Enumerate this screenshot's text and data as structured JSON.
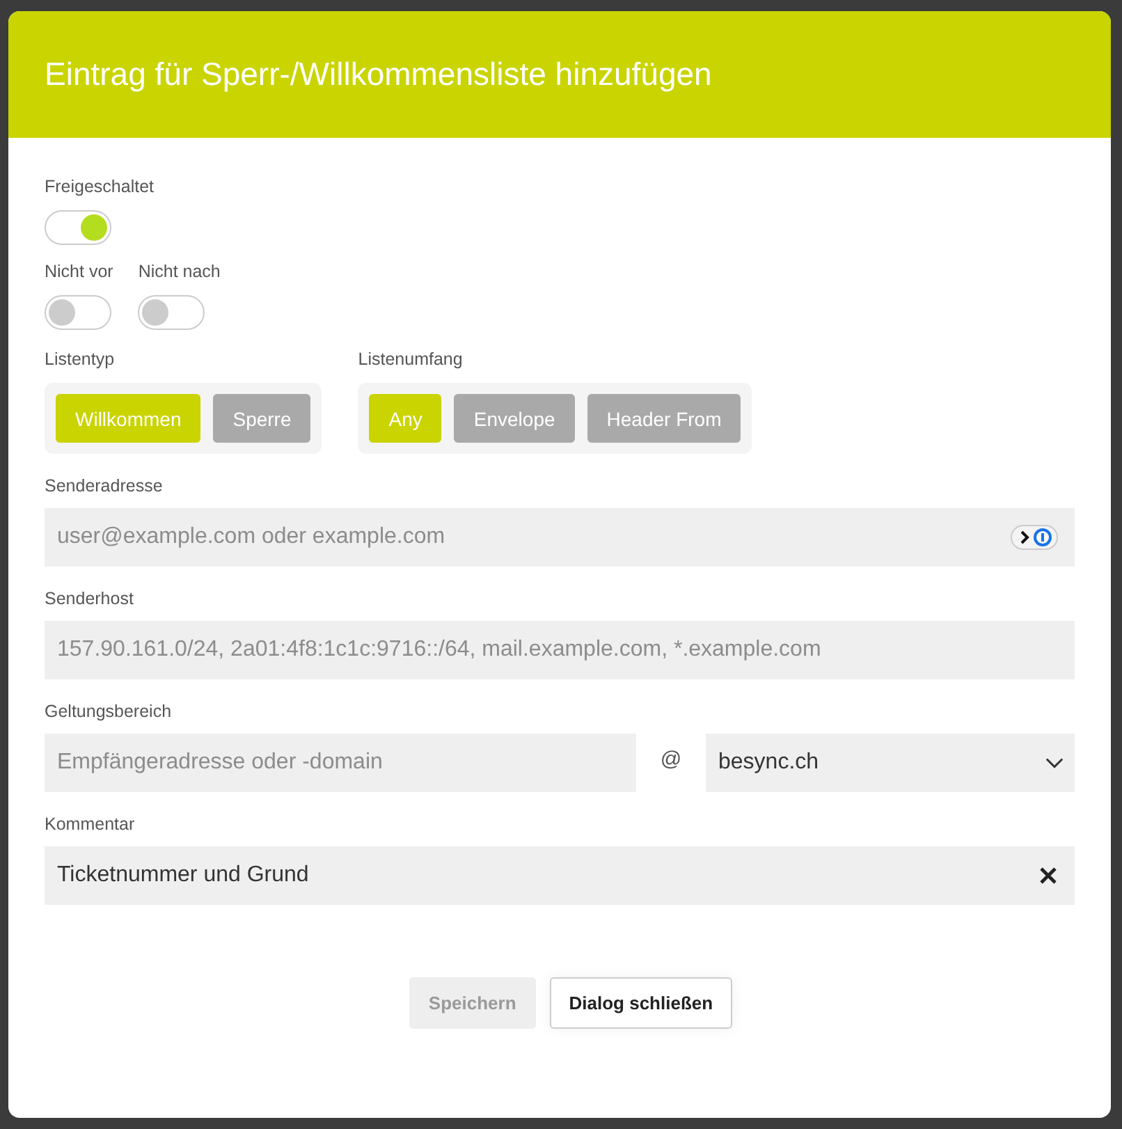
{
  "dialog": {
    "title": "Eintrag für Sperr-/Willkommensliste hinzufügen"
  },
  "switch_rows": [
    {
      "switches": [
        {
          "label": "Freigeschaltet",
          "on": true
        }
      ]
    },
    {
      "switches": [
        {
          "label": "Nicht vor",
          "on": false
        },
        {
          "label": "Nicht nach",
          "on": false
        }
      ]
    }
  ],
  "segment_groups": [
    {
      "label": "Listentyp",
      "options": [
        {
          "label": "Willkommen",
          "selected": true
        },
        {
          "label": "Sperre",
          "selected": false
        }
      ]
    },
    {
      "label": "Listenumfang",
      "options": [
        {
          "label": "Any",
          "selected": true
        },
        {
          "label": "Envelope",
          "selected": false
        },
        {
          "label": "Header From",
          "selected": false
        }
      ]
    }
  ],
  "fields": [
    {
      "kind": "text",
      "label": "Senderadresse",
      "placeholder": "user@example.com oder example.com",
      "password_manager": true
    },
    {
      "kind": "text",
      "label": "Senderhost",
      "placeholder": "157.90.161.0/24, 2a01:4f8:1c1c:9716::/64, mail.example.com, *.example.com"
    },
    {
      "kind": "scope",
      "label": "Geltungsbereich",
      "placeholder": "Empfängeradresse oder -domain",
      "separator": "@",
      "select_value": "besync.ch"
    },
    {
      "kind": "text",
      "label": "Kommentar",
      "value": "Ticketnummer und Grund",
      "clearable": true
    }
  ],
  "buttons": [
    {
      "label": "Speichern",
      "disabled": true
    },
    {
      "label": "Dialog schließen",
      "disabled": false
    }
  ]
}
